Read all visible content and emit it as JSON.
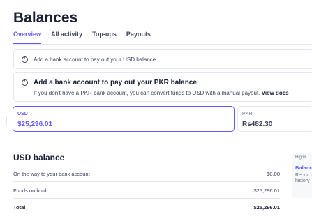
{
  "page": {
    "title": "Balances"
  },
  "tabs": [
    {
      "label": "Overview",
      "active": true
    },
    {
      "label": "All activity",
      "active": false
    },
    {
      "label": "Top-ups",
      "active": false
    },
    {
      "label": "Payouts",
      "active": false
    }
  ],
  "banners": {
    "usd_notice": "Add a bank account to pay out your USD balance",
    "pkr_title": "Add a bank account to pay out your PKR balance",
    "pkr_body": "If you don't have a PKR bank account, you can convert funds to USD with a manual payout.",
    "pkr_link": "View docs"
  },
  "balance_cards": [
    {
      "currency": "USD",
      "amount": "$25,296.01",
      "selected": true
    },
    {
      "currency": "PKR",
      "amount": "Rs482.30",
      "selected": false
    }
  ],
  "usd_balance": {
    "title": "USD balance",
    "rows": [
      {
        "label": "On the way to your bank account",
        "value": "$0.00"
      },
      {
        "label": "Funds on hold",
        "value": "$25,296.01"
      },
      {
        "label": "Total",
        "value": "$25,296.01"
      }
    ]
  },
  "highlight_panel": {
    "tag": "Highli",
    "title": "Balanc",
    "body": "Recon downl history"
  },
  "colors": {
    "accent": "#635bff",
    "text": "#1a1f36",
    "border": "#e3e8ee"
  },
  "icons": {
    "notice": "info-circle-icon"
  }
}
